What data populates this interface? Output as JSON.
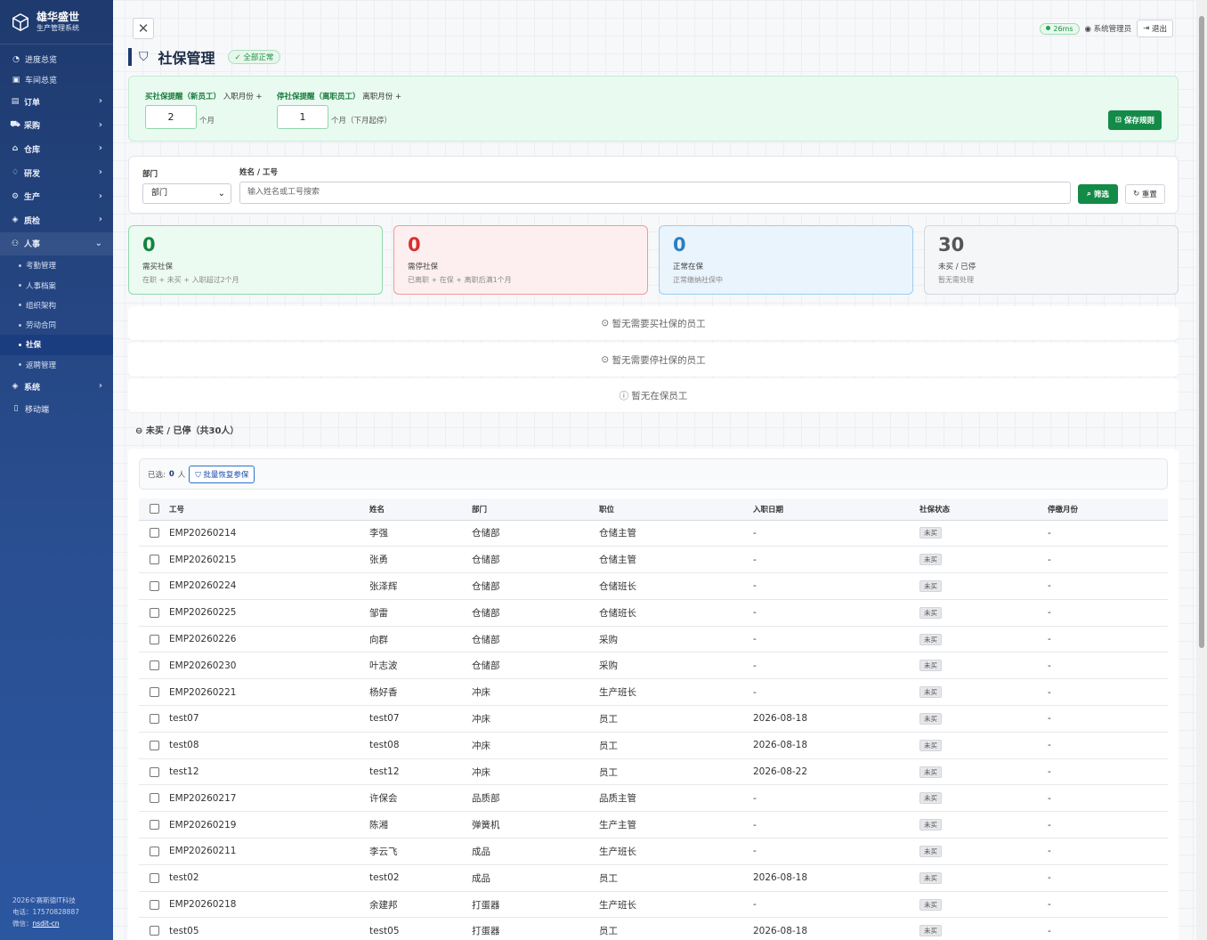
{
  "brand": {
    "name": "雄华盛世",
    "subtitle": "生产管理系统"
  },
  "sidebar": {
    "items": [
      {
        "icon": "dashboard-icon",
        "glyph": "◔",
        "label": "进度总览",
        "type": "l1"
      },
      {
        "icon": "workshop-icon",
        "glyph": "▣",
        "label": "车间总览",
        "type": "l1"
      },
      {
        "icon": "order-icon",
        "glyph": "▤",
        "label": "订单",
        "type": "grp"
      },
      {
        "icon": "cart-icon",
        "glyph": "⛟",
        "label": "采购",
        "type": "grp"
      },
      {
        "icon": "warehouse-icon",
        "glyph": "⌂",
        "label": "仓库",
        "type": "grp"
      },
      {
        "icon": "bulb-icon",
        "glyph": "♢",
        "label": "研发",
        "type": "grp"
      },
      {
        "icon": "gear-icon",
        "glyph": "⚙",
        "label": "生产",
        "type": "grp"
      },
      {
        "icon": "shield-icon",
        "glyph": "◈",
        "label": "质检",
        "type": "grp"
      },
      {
        "icon": "people-icon",
        "glyph": "⚇",
        "label": "人事",
        "type": "grp",
        "open": true
      },
      {
        "label": "考勤管理",
        "type": "sub"
      },
      {
        "label": "人事档案",
        "type": "sub"
      },
      {
        "label": "组织架构",
        "type": "sub"
      },
      {
        "label": "劳动合同",
        "type": "sub"
      },
      {
        "label": "社保",
        "type": "sub",
        "active": true
      },
      {
        "label": "返聘管理",
        "type": "sub"
      },
      {
        "icon": "system-shield-icon",
        "glyph": "◈",
        "label": "系统",
        "type": "grp"
      },
      {
        "icon": "mobile-icon",
        "glyph": "▯",
        "label": "移动端",
        "type": "l1"
      }
    ],
    "footer": {
      "copyright": "2026©赛斯德IT科技",
      "phone": "电话：17570828887",
      "wechat_label": "微信：",
      "wechat": "nsdit-cn"
    }
  },
  "topbar": {
    "latency": "26ms",
    "user": "系统管理员",
    "logout": "退出"
  },
  "page": {
    "title": "社保管理",
    "status": "全部正常"
  },
  "rules": {
    "buy_label": "买社保提醒（新员工）",
    "buy_suffix": "入职月份 +",
    "buy_value": "2",
    "buy_unit": "个月",
    "stop_label": "停社保提醒（离职员工）",
    "stop_suffix": "离职月份 +",
    "stop_value": "1",
    "stop_unit": "个月（下月起停）",
    "save": "保存规则"
  },
  "filter": {
    "dept_label": "部门",
    "dept_value": "部门",
    "name_label": "姓名 / 工号",
    "name_placeholder": "输入姓名或工号搜索",
    "search": "筛选",
    "reset": "重置"
  },
  "cards": [
    {
      "num": "0",
      "label": "需买社保",
      "sub": "在职 + 未买 + 入职超过2个月"
    },
    {
      "num": "0",
      "label": "需停社保",
      "sub": "已离职 + 在保 + 离职后满1个月"
    },
    {
      "num": "0",
      "label": "正常在保",
      "sub": "正常缴纳社保中"
    },
    {
      "num": "30",
      "label": "未买 / 已停",
      "sub": "暂无需处理"
    }
  ],
  "empty": {
    "buy": "暂无需要买社保的员工",
    "stop": "暂无需要停社保的员工",
    "active": "暂无在保员工"
  },
  "section": {
    "title": "未买 / 已停（共30人）",
    "selected_label": "已选:",
    "selected_count": "0",
    "selected_unit": "人",
    "batch": "批量恢复参保"
  },
  "table": {
    "headers": [
      "工号",
      "姓名",
      "部门",
      "职位",
      "入职日期",
      "社保状态",
      "停缴月份"
    ],
    "rows": [
      [
        "EMP20260214",
        "李强",
        "仓储部",
        "仓储主管",
        "-",
        "未买",
        "-"
      ],
      [
        "EMP20260215",
        "张勇",
        "仓储部",
        "仓储主管",
        "-",
        "未买",
        "-"
      ],
      [
        "EMP20260224",
        "张泽辉",
        "仓储部",
        "仓储班长",
        "-",
        "未买",
        "-"
      ],
      [
        "EMP20260225",
        "邹雷",
        "仓储部",
        "仓储班长",
        "-",
        "未买",
        "-"
      ],
      [
        "EMP20260226",
        "向群",
        "仓储部",
        "采购",
        "-",
        "未买",
        "-"
      ],
      [
        "EMP20260230",
        "叶志波",
        "仓储部",
        "采购",
        "-",
        "未买",
        "-"
      ],
      [
        "EMP20260221",
        "杨好香",
        "冲床",
        "生产班长",
        "-",
        "未买",
        "-"
      ],
      [
        "test07",
        "test07",
        "冲床",
        "员工",
        "2026-08-18",
        "未买",
        "-"
      ],
      [
        "test08",
        "test08",
        "冲床",
        "员工",
        "2026-08-18",
        "未买",
        "-"
      ],
      [
        "test12",
        "test12",
        "冲床",
        "员工",
        "2026-08-22",
        "未买",
        "-"
      ],
      [
        "EMP20260217",
        "许保会",
        "品质部",
        "品质主管",
        "-",
        "未买",
        "-"
      ],
      [
        "EMP20260219",
        "陈湘",
        "弹簧机",
        "生产主管",
        "-",
        "未买",
        "-"
      ],
      [
        "EMP20260211",
        "李云飞",
        "成品",
        "生产班长",
        "-",
        "未买",
        "-"
      ],
      [
        "test02",
        "test02",
        "成品",
        "员工",
        "2026-08-18",
        "未买",
        "-"
      ],
      [
        "EMP20260218",
        "余建邦",
        "打蛋器",
        "生产班长",
        "-",
        "未买",
        "-"
      ],
      [
        "test05",
        "test05",
        "打蛋器",
        "员工",
        "2026-08-18",
        "未买",
        "-"
      ]
    ]
  }
}
